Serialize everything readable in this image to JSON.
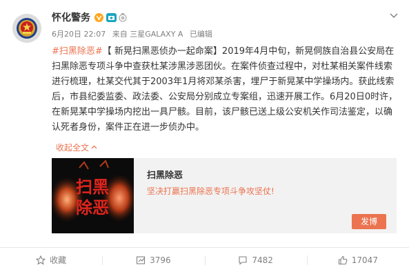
{
  "post": {
    "author": "怀化警务",
    "timestamp": "6月20日 22:07",
    "source_prefix": "来自",
    "device": "三星GALAXY A",
    "edited": "已编辑",
    "topic": "#扫黑除恶#",
    "body": "【 新晃扫黑恶侦办一起命案】2019年4月中旬，新晃侗族自治县公安局在扫黑除恶专项斗争中查获杜某涉黑涉恶团伙。在案件侦查过程中，对杜某相关案件线索进行梳理，杜某交代其于2003年1月将邓某杀害，埋尸于新晃某中学操场内。获此线索后，市县纪委监委、政法委、公安局分别成立专案组，迅速开展工作。6月20日0时许，在新晃某中学操场内挖出一具尸骸。目前，该尸骸已送上级公安机关作司法鉴定，以确认死者身份，案件正在进一步侦办中。",
    "collapse_label": "收起全文"
  },
  "card": {
    "image_text_line1": "扫黑",
    "image_text_line2": "除恶",
    "title": "扫黑除恶",
    "description": "坚决打赢扫黑除恶专项斗争攻坚仗!",
    "button_label": "发博"
  },
  "actions": {
    "favorite_label": "收藏",
    "repost_count": "3796",
    "comment_count": "7482",
    "like_count": "17047"
  },
  "icons": {
    "verified": "verified-v-icon",
    "camera": "camera-badge-icon",
    "medal": "medal-badge-icon",
    "more": "chevron-down-icon"
  },
  "colors": {
    "accent": "#eb7350",
    "verified": "#ffa61a",
    "camera_badge": "#1aa5bd"
  }
}
